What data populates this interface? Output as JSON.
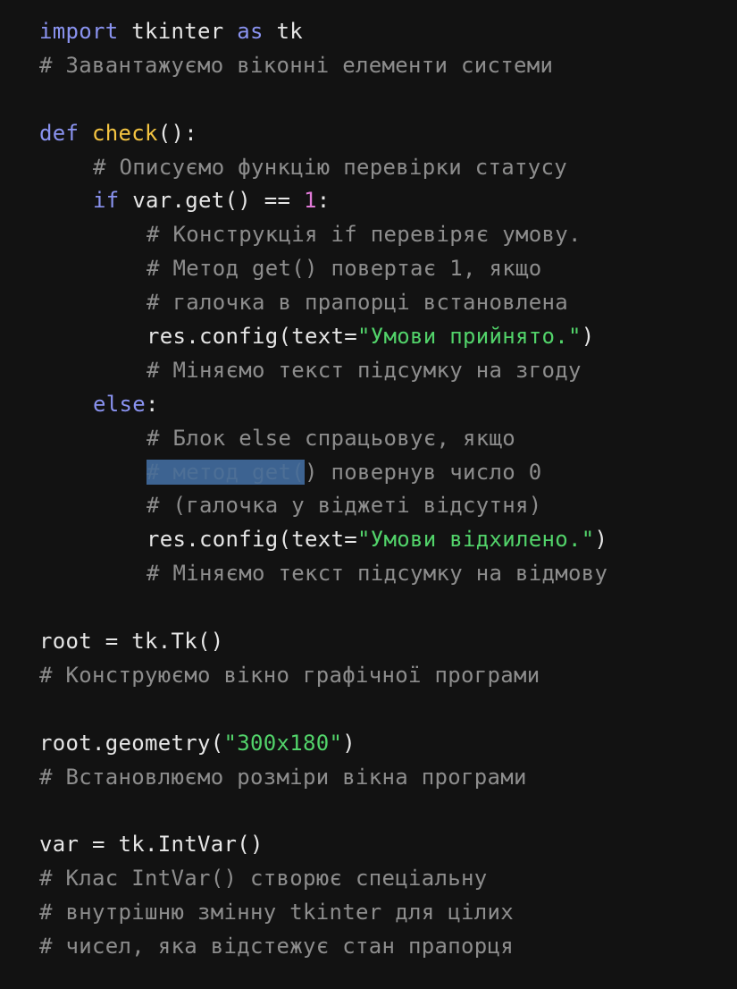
{
  "code": {
    "l1": {
      "kw_import": "import",
      "mod": " tkinter ",
      "kw_as": "as",
      "alias": " tk"
    },
    "l2": {
      "comment": "# Завантажуємо віконні елементи системи"
    },
    "l4": {
      "kw_def": "def",
      "sp": " ",
      "fn_name": "check",
      "rest": "():"
    },
    "l5": {
      "comment": "# Описуємо функцію перевірки статусу"
    },
    "l6": {
      "kw_if": "if",
      "expr": " var.get() == ",
      "num": "1",
      "colon": ":"
    },
    "l7": {
      "comment": "# Конструкція if перевіряє умову."
    },
    "l8": {
      "comment": "# Метод get() повертає 1, якщо"
    },
    "l9": {
      "comment": "# галочка в прапорці встановлена"
    },
    "l10": {
      "call": "res.config(text=",
      "str": "\"Умови прийнято.\"",
      "close": ")"
    },
    "l11": {
      "comment": "# Міняємо текст підсумку на згоду"
    },
    "l12": {
      "kw_else": "else",
      "colon": ":"
    },
    "l13": {
      "comment": "# Блок else спрацьовує, якщо"
    },
    "l14": {
      "selected": "# метод get(",
      "rest": ") повернув число 0"
    },
    "l15": {
      "comment": "# (галочка у віджеті відсутня)"
    },
    "l16": {
      "call": "res.config(text=",
      "str": "\"Умови відхилено.\"",
      "close": ")"
    },
    "l17": {
      "comment": "# Міняємо текст підсумку на відмову"
    },
    "l19": {
      "code": "root = tk.Tk()"
    },
    "l20": {
      "comment": "# Конструюємо вікно графічної програми"
    },
    "l22": {
      "call": "root.geometry(",
      "str": "\"300x180\"",
      "close": ")"
    },
    "l23": {
      "comment": "# Встановлюємо розміри вікна програми"
    },
    "l25": {
      "code": "var = tk.IntVar()"
    },
    "l26": {
      "comment": "# Клас IntVar() створює спеціальну"
    },
    "l27": {
      "comment": "# внутрішню змінну tkinter для цілих"
    },
    "l28": {
      "comment": "# чисел, яка відстежує стан прапорця"
    }
  },
  "colors": {
    "background": "#121212",
    "keyword": "#8a93f0",
    "function": "#f5c542",
    "number": "#e07ad7",
    "string": "#52d36a",
    "comment": "#8d8d8d",
    "text": "#e6e6e6",
    "selection": "#3d6391"
  }
}
